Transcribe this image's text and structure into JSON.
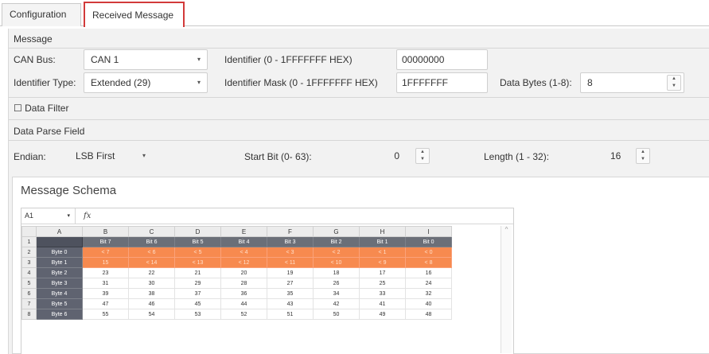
{
  "tabs": {
    "configuration": "Configuration",
    "received_message": "Received Message"
  },
  "message": {
    "section_title": "Message",
    "can_bus_label": "CAN Bus:",
    "can_bus_value": "CAN 1",
    "identifier_label": "Identifier (0 - 1FFFFFFF HEX)",
    "identifier_value": "00000000",
    "identifier_type_label": "Identifier Type:",
    "identifier_type_value": "Extended (29)",
    "identifier_mask_label": "Identifier Mask (0 - 1FFFFFFF HEX)",
    "identifier_mask_value": "1FFFFFFF",
    "data_bytes_label": "Data Bytes (1-8):",
    "data_bytes_value": "8"
  },
  "data_filter": {
    "checkbox_glyph": "☐",
    "label": "Data Filter"
  },
  "parse": {
    "section_title": "Data Parse Field",
    "endian_label": "Endian:",
    "endian_value": "LSB First",
    "start_bit_label": "Start Bit (0- 63):",
    "start_bit_value": "0",
    "length_label": "Length (1 - 32):",
    "length_value": "16"
  },
  "schema": {
    "title": "Message Schema",
    "cell_ref": "A1",
    "fx": "fx",
    "columns": [
      "A",
      "B",
      "C",
      "D",
      "E",
      "F",
      "G",
      "H",
      "I"
    ],
    "header_row": [
      "",
      "Bit 7",
      "Bit 6",
      "Bit 5",
      "Bit 4",
      "Bit 3",
      "Bit 2",
      "Bit 1",
      "Bit 0"
    ],
    "rows": [
      {
        "num": "2",
        "label": "Byte 0",
        "cells": [
          "< 7",
          "< 6",
          "< 5",
          "< 4",
          "< 3",
          "< 2",
          "< 1",
          "< 0"
        ],
        "highlight": true
      },
      {
        "num": "3",
        "label": "Byte 1",
        "cells": [
          "15",
          "< 14",
          "< 13",
          "< 12",
          "< 11",
          "< 10",
          "< 9",
          "< 8"
        ],
        "highlight": true
      },
      {
        "num": "4",
        "label": "Byte 2",
        "cells": [
          "23",
          "22",
          "21",
          "20",
          "19",
          "18",
          "17",
          "16"
        ],
        "highlight": false
      },
      {
        "num": "5",
        "label": "Byte 3",
        "cells": [
          "31",
          "30",
          "29",
          "28",
          "27",
          "26",
          "25",
          "24"
        ],
        "highlight": false
      },
      {
        "num": "6",
        "label": "Byte 4",
        "cells": [
          "39",
          "38",
          "37",
          "36",
          "35",
          "34",
          "33",
          "32"
        ],
        "highlight": false
      },
      {
        "num": "7",
        "label": "Byte 5",
        "cells": [
          "47",
          "46",
          "45",
          "44",
          "43",
          "42",
          "41",
          "40"
        ],
        "highlight": false
      },
      {
        "num": "8",
        "label": "Byte 6",
        "cells": [
          "55",
          "54",
          "53",
          "52",
          "51",
          "50",
          "49",
          "48"
        ],
        "highlight": false
      }
    ]
  },
  "colors": {
    "active_tab_border": "#d23a3a",
    "highlight": "#f78a4f",
    "header_dark": "#6b6f78"
  },
  "icons": {
    "caret": "▾",
    "spin_up": "▲",
    "spin_down": "▼",
    "scroll_up": "^"
  }
}
